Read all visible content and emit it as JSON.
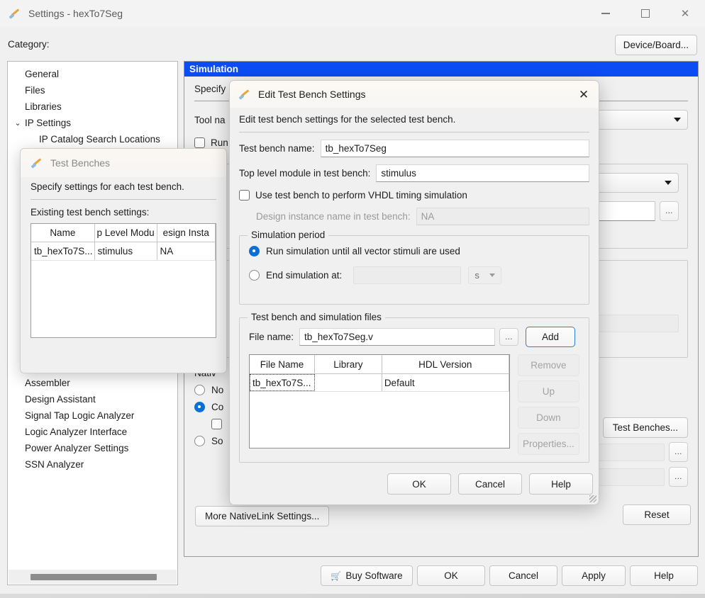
{
  "window": {
    "title": "Settings - hexTo7Seg",
    "icon": "brush-icon",
    "minimize": "minimize-icon",
    "maximize": "maximize-icon",
    "close": "close-icon"
  },
  "toolbar": {
    "category_label": "Category:",
    "device_board_button": "Device/Board..."
  },
  "category_tree": {
    "items": [
      {
        "label": "General",
        "indent": 0,
        "chevron": ""
      },
      {
        "label": "Files",
        "indent": 0,
        "chevron": ""
      },
      {
        "label": "Libraries",
        "indent": 0,
        "chevron": ""
      },
      {
        "label": "IP Settings",
        "indent": 0,
        "chevron": "⌄"
      },
      {
        "label": "IP Catalog Search Locations",
        "indent": 1,
        "chevron": ""
      },
      {
        "label": "Assembler",
        "indent": 0,
        "chevron": ""
      },
      {
        "label": "Design Assistant",
        "indent": 0,
        "chevron": ""
      },
      {
        "label": "Signal Tap Logic Analyzer",
        "indent": 0,
        "chevron": ""
      },
      {
        "label": "Logic Analyzer Interface",
        "indent": 0,
        "chevron": ""
      },
      {
        "label": "Power Analyzer Settings",
        "indent": 0,
        "chevron": ""
      },
      {
        "label": "SSN Analyzer",
        "indent": 0,
        "chevron": ""
      }
    ],
    "hidden_chevrons": [
      "⌄",
      "⌄",
      "⌄",
      "⌄",
      "⌄"
    ]
  },
  "simulation_panel": {
    "header": "Simulation",
    "description_prefix": "Specify",
    "tool_name_label": "Tool na",
    "run_gate_label": "Run",
    "nativelink_label": "Nativ",
    "nativelink_options": [
      "No",
      "Co",
      "So"
    ],
    "test_benches_button": "Test Benches...",
    "more_nativelink_button": "More NativeLink Settings...",
    "reset_button": "Reset",
    "dots_button": "..."
  },
  "bottom_bar": {
    "buy_software": "Buy Software",
    "buy_icon": "cart-icon",
    "ok": "OK",
    "cancel": "Cancel",
    "apply": "Apply",
    "help": "Help"
  },
  "test_benches_dialog": {
    "title": "Test Benches",
    "icon": "brush-icon",
    "description": "Specify settings for each test bench.",
    "list_label": "Existing test bench settings:",
    "columns": [
      "Name",
      "p Level Modu",
      "esign Insta"
    ],
    "rows": [
      {
        "name": "tb_hexTo7S...",
        "top_level_module": "stimulus",
        "design_instance": "NA"
      }
    ]
  },
  "edit_dialog": {
    "title": "Edit Test Bench Settings",
    "icon": "brush-icon",
    "close_icon": "close-icon",
    "description": "Edit test bench settings for the selected test bench.",
    "test_bench_name_label": "Test bench name:",
    "test_bench_name_value": "tb_hexTo7Seg",
    "top_level_label": "Top level module in test bench:",
    "top_level_value": "stimulus",
    "vhdl_checkbox_label": "Use test bench to perform VHDL timing simulation",
    "vhdl_checkbox_checked": false,
    "design_instance_label": "Design instance name in test bench:",
    "design_instance_value": "NA",
    "simulation_period": {
      "group_title": "Simulation period",
      "option_run_all": "Run simulation until all vector stimuli are used",
      "option_end_at": "End simulation at:",
      "selected": "run_all",
      "end_at_value": "",
      "unit_value": "s"
    },
    "files_group": {
      "group_title": "Test bench and simulation files",
      "file_name_label": "File name:",
      "file_name_value": "tb_hexTo7Seg.v",
      "browse_button": "...",
      "add_button": "Add",
      "columns": [
        "File Name",
        "Library",
        "HDL Version"
      ],
      "rows": [
        {
          "file_name": "tb_hexTo7S...",
          "library": "",
          "hdl_version": "Default"
        }
      ],
      "side_buttons": [
        "Remove",
        "Up",
        "Down",
        "Properties..."
      ]
    },
    "footer_buttons": {
      "ok": "OK",
      "cancel": "Cancel",
      "help": "Help"
    }
  },
  "colors": {
    "header_blue": "#0c4cf5",
    "accent_blue": "#0b6fd6",
    "add_border": "#2b7fd4",
    "window_bg": "#f0f0f0"
  }
}
